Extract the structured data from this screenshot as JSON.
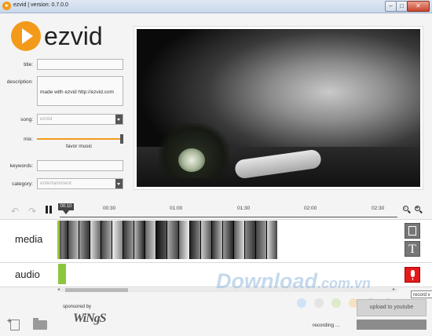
{
  "window": {
    "title": "ezvid | version: 0.7.0.0",
    "min": "–",
    "max": "□",
    "close": "✕"
  },
  "logo": {
    "text": "ezvid"
  },
  "form": {
    "title_label": "title:",
    "title_value": "",
    "description_label": "description:",
    "description_value": "made with ezvid http://ezvid.com",
    "song_label": "song:",
    "song_value": "ezvid",
    "mix_label": "mix:",
    "mix_caption": "favor music",
    "mix_level": 1.0,
    "keywords_label": "keywords:",
    "keywords_value": "",
    "category_label": "category:",
    "category_value": "entertainment"
  },
  "timeline": {
    "undo": "↶",
    "redo": "↷",
    "playhead": "00:10",
    "ticks": [
      "00:30",
      "01:00",
      "01:30",
      "02:00",
      "02:30"
    ]
  },
  "tracks": {
    "media_label": "media",
    "audio_label": "audio",
    "text_button": "T"
  },
  "tooltip": {
    "record": "record v"
  },
  "bottom": {
    "sponsored": "sponsored by",
    "sponsor_logo": "WiNgS",
    "upload_button": "upload to youtube",
    "status": "recording ..."
  },
  "watermark": {
    "main": "Download",
    "suffix": ".com.vn"
  },
  "colors": {
    "accent": "#f39a1b",
    "audio_clip": "#8cc63f",
    "record": "#e31b1b"
  }
}
